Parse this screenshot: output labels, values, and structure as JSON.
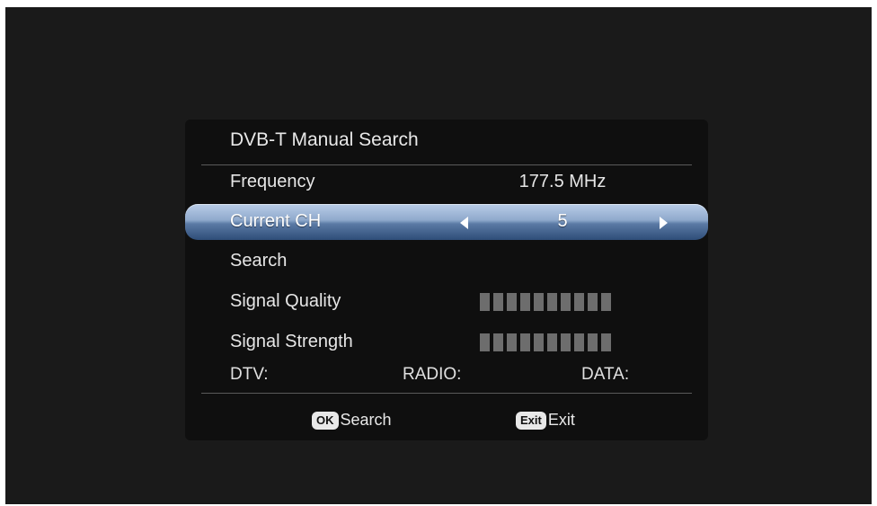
{
  "menu": {
    "title": "DVB-T Manual Search",
    "frequency": {
      "label": "Frequency",
      "value": "177.5 MHz"
    },
    "current_ch": {
      "label": "Current CH",
      "value": "5"
    },
    "search": {
      "label": "Search"
    },
    "signal_quality": {
      "label": "Signal Quality",
      "level": 0,
      "segments": 10
    },
    "signal_strength": {
      "label": "Signal Strength",
      "level": 0,
      "segments": 10
    },
    "counts": {
      "dtv": "DTV:",
      "radio": "RADIO:",
      "data": "DATA:"
    }
  },
  "footer": {
    "ok_key": "OK",
    "ok_label": "Search",
    "exit_key": "Exit",
    "exit_label": "Exit"
  },
  "colors": {
    "panel_bg": "#0f0f0f",
    "highlight_top": "#b9cde8",
    "highlight_bottom": "#2e4d78",
    "meter_off": "#6d6d6d"
  },
  "icons": {
    "left": "triangle-left-icon",
    "right": "triangle-right-icon"
  }
}
